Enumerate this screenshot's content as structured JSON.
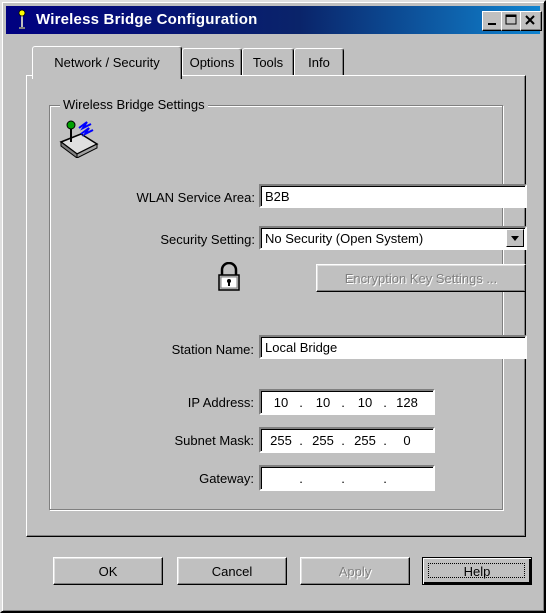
{
  "window": {
    "title": "Wireless Bridge Configuration"
  },
  "tabs": [
    {
      "label": "Network / Security",
      "active": true
    },
    {
      "label": "Options",
      "active": false
    },
    {
      "label": "Tools",
      "active": false
    },
    {
      "label": "Info",
      "active": false
    }
  ],
  "group": {
    "label": "Wireless Bridge Settings"
  },
  "fields": {
    "wlan_label": "WLAN Service Area:",
    "wlan_value": "B2B",
    "security_label": "Security Setting:",
    "security_value": "No Security (Open System)",
    "encryption_button": "Encryption Key Settings ...",
    "station_label": "Station Name:",
    "station_value": "Local Bridge",
    "ip_label": "IP Address:",
    "ip": [
      "10",
      "10",
      "10",
      "128"
    ],
    "mask_label": "Subnet Mask:",
    "mask": [
      "255",
      "255",
      "255",
      "0"
    ],
    "gateway_label": "Gateway:",
    "gateway": [
      "",
      "",
      "",
      ""
    ]
  },
  "buttons": {
    "ok": "OK",
    "cancel": "Cancel",
    "apply": "Apply",
    "help": "Help"
  },
  "icons": [
    "bridge-antenna-icon",
    "lock-icon",
    "minimize-icon",
    "maximize-icon",
    "close-icon",
    "dropdown-arrow-icon"
  ],
  "colors": {
    "titlebar": "#000080",
    "face": "#c0c0c0",
    "disabled_text": "#808080"
  }
}
